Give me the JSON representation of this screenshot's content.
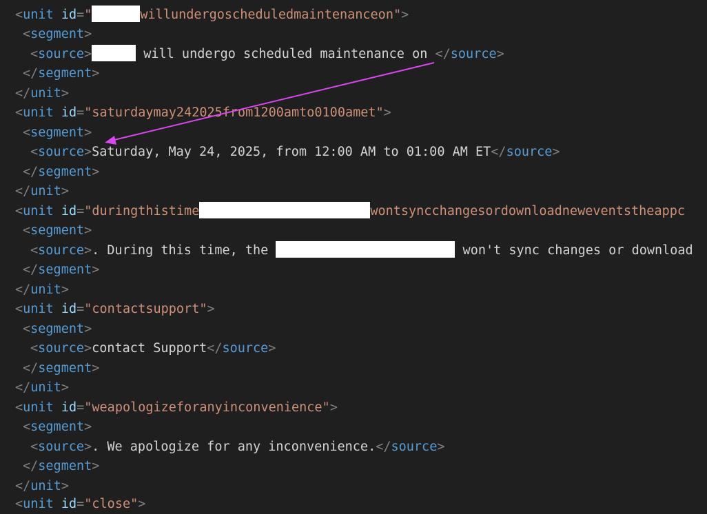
{
  "editor": {
    "units": [
      {
        "id_text": "willundergoscheduledmaintenanceon",
        "source_text": " will undergo scheduled maintenance on "
      },
      {
        "id_text": "saturdaymay242025from1200amto0100amet",
        "source_text": "Saturday, May 24, 2025, from 12:00 AM to 01:00 AM ET"
      },
      {
        "id_text_before": "duringthistime",
        "id_text_after": "wontsyncchangesordownloadneweventstheappc",
        "source_text_before": ". During this time, the ",
        "source_text_after": " won't sync changes or download"
      },
      {
        "id_text": "contactsupport",
        "source_text": "contact Support"
      },
      {
        "id_text": "weapologizeforanyinconvenience",
        "source_text": ". We apologize for any inconvenience."
      },
      {
        "id_text": "close"
      }
    ],
    "tokens": {
      "unit": "unit",
      "segment": "segment",
      "source": "source",
      "id_attr": "id",
      "lt": "<",
      "gt": ">",
      "lt_slash": "</",
      "eq": "=",
      "quote": "\""
    },
    "annotation": {
      "arrow_color": "#d946ef"
    }
  }
}
